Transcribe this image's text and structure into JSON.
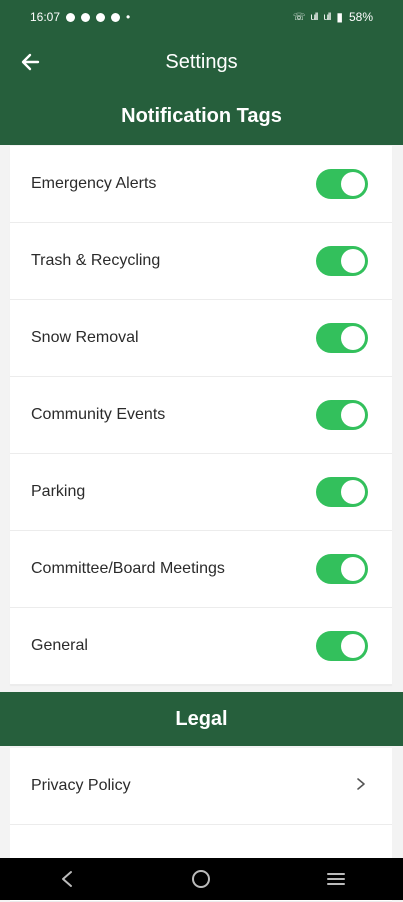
{
  "status": {
    "time": "16:07",
    "signal_text": "ull",
    "battery": "58%"
  },
  "appbar": {
    "title": "Settings",
    "back_icon": "arrow-left-icon"
  },
  "notification_section": {
    "title": "Notification Tags",
    "tags": [
      {
        "label": "Emergency Alerts",
        "enabled": true
      },
      {
        "label": "Trash & Recycling",
        "enabled": true
      },
      {
        "label": "Snow Removal",
        "enabled": true
      },
      {
        "label": "Community Events",
        "enabled": true
      },
      {
        "label": "Parking",
        "enabled": true
      },
      {
        "label": "Committee/Board Meetings",
        "enabled": true
      },
      {
        "label": "General",
        "enabled": true
      }
    ]
  },
  "legal_section": {
    "title": "Legal",
    "items": [
      {
        "label": "Privacy Policy",
        "icon": "chevron-right-icon"
      },
      {
        "label": "",
        "icon": ""
      }
    ]
  },
  "colors": {
    "brand_green": "#265f3c",
    "toggle_on": "#33c05c"
  }
}
